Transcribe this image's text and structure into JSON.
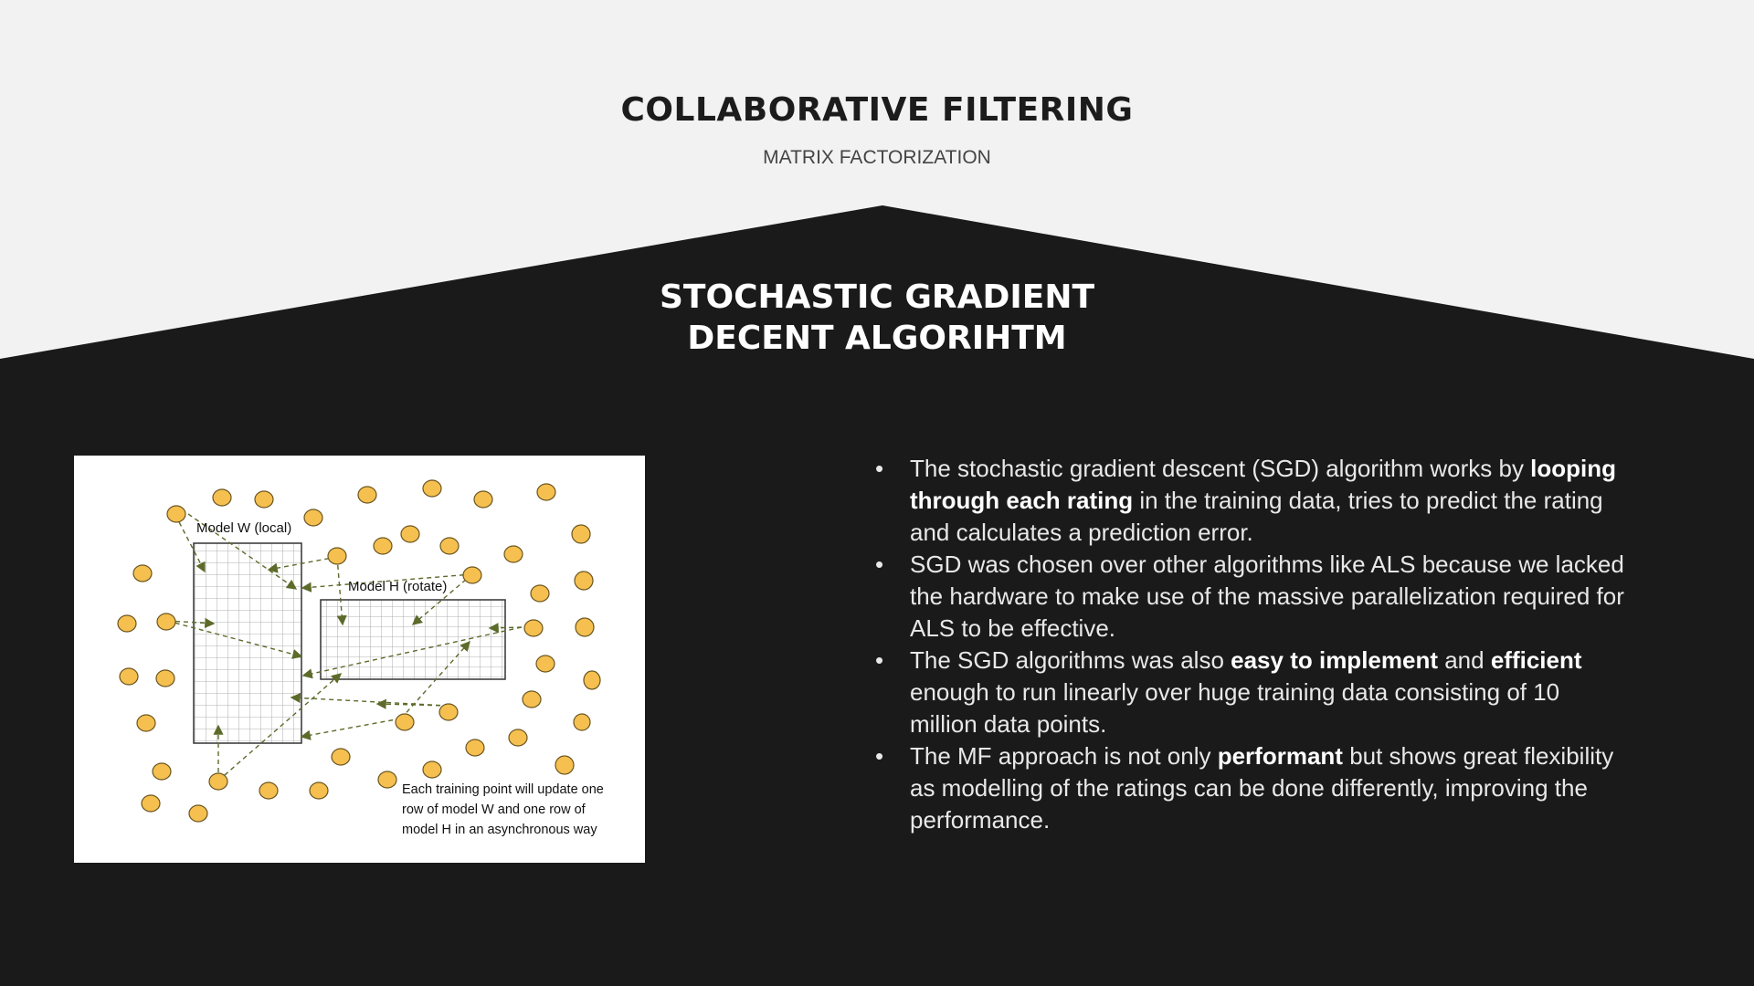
{
  "slide": {
    "title": "COLLABORATIVE FILTERING",
    "subtitle": "MATRIX FACTORIZATION",
    "section_title_line1": "STOCHASTIC GRADIENT",
    "section_title_line2": "DECENT ALGORIHTM"
  },
  "diagram": {
    "model_w_label": "Model W (local)",
    "model_h_label": "Model H (rotate)",
    "caption_line1": "Each training point will update one",
    "caption_line2": "row of model W and one row of",
    "caption_line3": "model H in an asynchronous way"
  },
  "bullets": [
    {
      "marker": "•",
      "p1": "The stochastic gradient descent (SGD) algorithm works by ",
      "b1": "looping through each rating",
      "p2": " in the training data, tries to predict the rating and calculates a prediction error."
    },
    {
      "marker": "•",
      "p1": "SGD was chosen over other algorithms like ALS because we lacked the hardware to make use of the massive parallelization required for ALS to be effective."
    },
    {
      "marker": "•",
      "p1": "The SGD algorithms was also ",
      "b1": "easy to implement",
      "p2": " and ",
      "b2": "efficient",
      "p3": " enough to run linearly over huge training data consisting of 10 million data points."
    },
    {
      "marker": "•",
      "p1": "The MF approach is not only ",
      "b1": "performant",
      "p2": " but shows great flexibility as modelling of the ratings can be done differently, improving the performance."
    }
  ],
  "colors": {
    "background_light": "#f2f2f2",
    "background_dark": "#1a1a1a",
    "point_fill": "#f5c04f",
    "arrow_color": "#5c6b2a"
  }
}
